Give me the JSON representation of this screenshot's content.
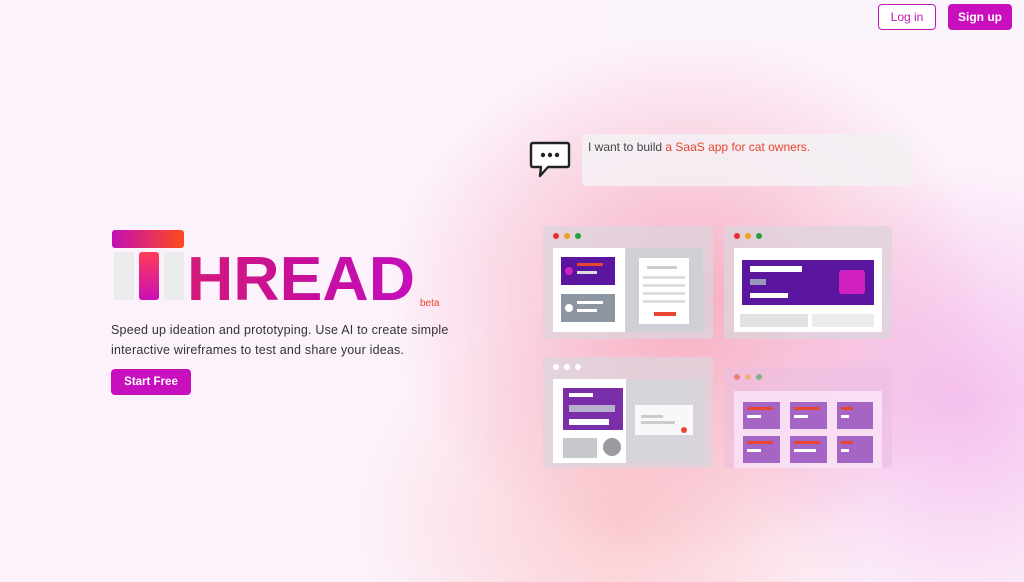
{
  "header": {
    "login_label": "Log in",
    "signup_label": "Sign up"
  },
  "hero": {
    "logo_text": "HREAD",
    "beta_label": "beta",
    "tagline_line1": "Speed up ideation and prototyping. Use AI to create simple",
    "tagline_line2": "interactive wireframes to test and share your ideas.",
    "cta_label": "Start Free"
  },
  "prompt": {
    "text_prefix": "I want to build ",
    "text_highlight": "a SaaS app for cat owners."
  },
  "colors": {
    "brand_magenta": "#c80fbd",
    "brand_purple": "#5a169f",
    "highlight_orange": "#e8462e",
    "background": "#fcf2fb"
  },
  "icons": {
    "chat": "chat-bubble-icon"
  }
}
